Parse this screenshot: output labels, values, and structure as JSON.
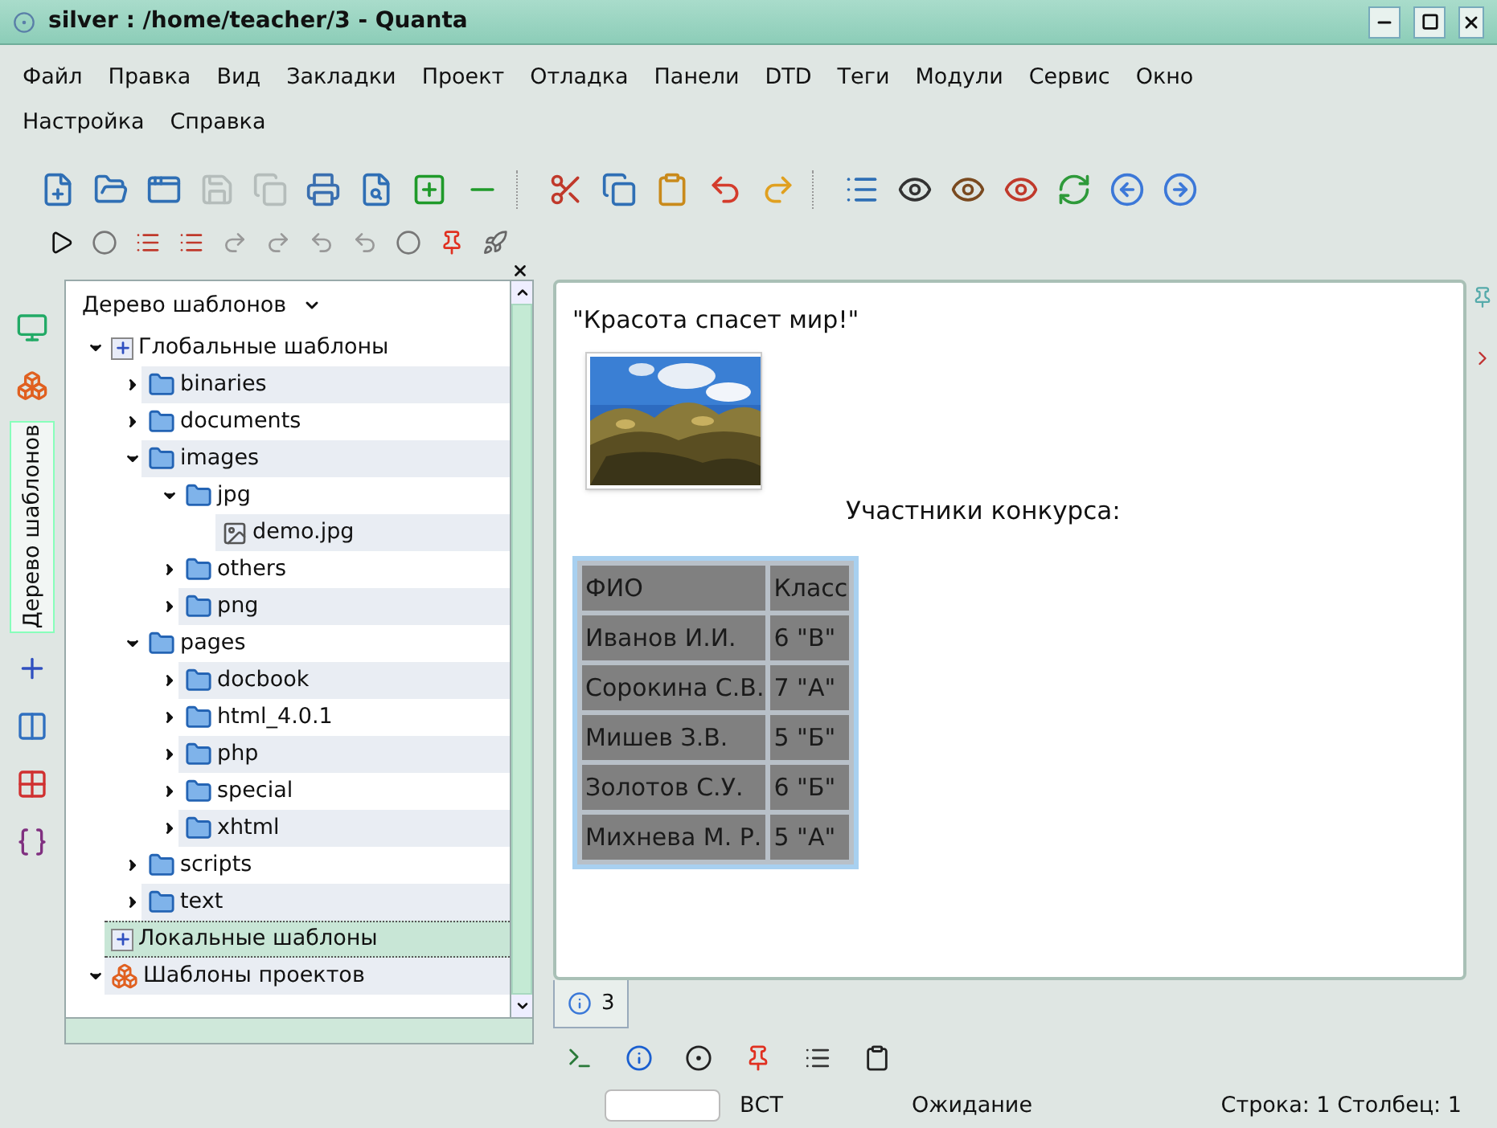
{
  "window": {
    "title": "silver : /home/teacher/3 - Quanta"
  },
  "menu": [
    "Файл",
    "Правка",
    "Вид",
    "Закладки",
    "Проект",
    "Отладка",
    "Панели",
    "DTD",
    "Теги",
    "Модули",
    "Сервис",
    "Окно",
    "Настройка",
    "Справка"
  ],
  "toolbar": [
    {
      "disabled": false
    },
    {
      "disabled": false
    },
    {
      "disabled": false
    },
    {
      "disabled": true
    },
    {
      "disabled": true
    },
    {
      "disabled": false
    },
    {
      "disabled": false
    },
    {
      "disabled": false
    },
    {
      "disabled": false
    },
    {
      "disabled": false
    },
    {
      "disabled": false
    },
    {
      "disabled": false
    },
    {
      "disabled": false
    },
    {
      "disabled": false
    },
    {
      "disabled": false
    },
    {
      "disabled": false
    },
    {
      "disabled": false
    },
    {
      "disabled": false
    },
    {
      "disabled": false
    },
    {
      "disabled": false
    },
    {
      "disabled": false
    }
  ],
  "side_tabs": [
    {
      "kind": "icon",
      "selected": false
    },
    {
      "kind": "icon",
      "selected": false
    },
    {
      "kind": "text",
      "label": "Дерево шаблонов",
      "selected": true
    },
    {
      "kind": "icon",
      "selected": false
    },
    {
      "kind": "icon",
      "selected": false
    },
    {
      "kind": "icon",
      "selected": false
    },
    {
      "kind": "icon",
      "selected": false
    }
  ],
  "tree_panel": {
    "title": "Дерево шаблонов",
    "items": [
      {
        "kind": "root",
        "label": "Глобальные шаблоны",
        "expanded": true,
        "selected": false,
        "children": [
          {
            "kind": "folder",
            "label": "binaries",
            "expanded": false,
            "selected": false
          },
          {
            "kind": "folder",
            "label": "documents",
            "expanded": false,
            "selected": false
          },
          {
            "kind": "folder",
            "label": "images",
            "expanded": true,
            "selected": false,
            "children": [
              {
                "kind": "folder",
                "label": "jpg",
                "expanded": true,
                "selected": false,
                "children": [
                  {
                    "kind": "file",
                    "label": "demo.jpg",
                    "selected": false
                  }
                ]
              },
              {
                "kind": "folder",
                "label": "others",
                "expanded": false,
                "selected": false
              },
              {
                "kind": "folder",
                "label": "png",
                "expanded": false,
                "selected": false
              }
            ]
          },
          {
            "kind": "folder",
            "label": "pages",
            "expanded": true,
            "selected": false,
            "children": [
              {
                "kind": "folder",
                "label": "docbook",
                "expanded": false,
                "selected": false
              },
              {
                "kind": "folder",
                "label": "html_4.0.1",
                "expanded": false,
                "selected": false
              },
              {
                "kind": "folder",
                "label": "php",
                "expanded": false,
                "selected": false
              },
              {
                "kind": "folder",
                "label": "special",
                "expanded": false,
                "selected": false
              },
              {
                "kind": "folder",
                "label": "xhtml",
                "expanded": false,
                "selected": false
              }
            ]
          },
          {
            "kind": "folder",
            "label": "scripts",
            "expanded": false,
            "selected": false
          },
          {
            "kind": "folder",
            "label": "text",
            "expanded": false,
            "selected": false
          }
        ]
      },
      {
        "kind": "local",
        "label": "Локальные шаблоны",
        "selected": true
      },
      {
        "kind": "project",
        "label": "Шаблоны проектов",
        "expanded": true,
        "selected": false
      }
    ]
  },
  "document": {
    "heading": "\"Красота спасет мир!\"",
    "caption": "Участники конкурса:",
    "table": {
      "columns": [
        "ФИО",
        "Класс"
      ],
      "rows": [
        [
          "Иванов И.И.",
          "6 \"В\""
        ],
        [
          "Сорокина С.В.",
          "7 \"А\""
        ],
        [
          "Мишев З.В.",
          "5 \"Б\""
        ],
        [
          "Золотов С.У.",
          "6 \"Б\""
        ],
        [
          "Михнева М. Р.",
          "5 \"А\""
        ]
      ]
    }
  },
  "doc_tabs": [
    {
      "label": "3",
      "selected": true
    }
  ],
  "status_bar": {
    "mode": "ВСТ",
    "state": "Ожидание",
    "position": "Строка: 1 Столбец: 1"
  }
}
